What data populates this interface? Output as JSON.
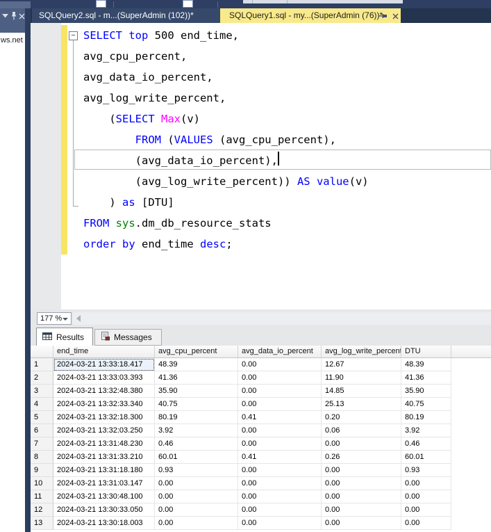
{
  "colors": {
    "title_strip": "#2E3F63",
    "tabbar_bg": "#24344F",
    "inactive_tab_bg": "#36496B",
    "active_tab_bg": "#F8E98B",
    "panel_header_bg": "#4D5F82",
    "change_bar_yellow": "#F7E464",
    "keyword_blue": "#0000FF",
    "function_magenta": "#FF00FF",
    "system_green": "#007F00"
  },
  "left_panel": {
    "server_text": "ws.net (S",
    "header_icons": [
      "chevron-down",
      "pin",
      "close"
    ]
  },
  "tabs": [
    {
      "label": "SQLQuery2.sql - m...(SuperAdmin (102))*",
      "active": false
    },
    {
      "label": "SQLQuery1.sql - my...(SuperAdmin (76))*",
      "active": true,
      "icons": [
        "pin",
        "close"
      ]
    }
  ],
  "editor": {
    "zoom_level": "177 %",
    "caret_line": 7,
    "lines": [
      [
        {
          "t": "SELECT",
          "c": "kw"
        },
        {
          "t": " ",
          "c": "pl"
        },
        {
          "t": "top",
          "c": "kw"
        },
        {
          "t": " 500 end_time,",
          "c": "pl"
        }
      ],
      [
        {
          "t": "avg_cpu_percent,",
          "c": "pl"
        }
      ],
      [
        {
          "t": "avg_data_io_percent,",
          "c": "pl"
        }
      ],
      [
        {
          "t": "avg_log_write_percent,",
          "c": "pl"
        }
      ],
      [
        {
          "t": "    (",
          "c": "pl"
        },
        {
          "t": "SELECT",
          "c": "kw"
        },
        {
          "t": " ",
          "c": "pl"
        },
        {
          "t": "Max",
          "c": "fn"
        },
        {
          "t": "(v)",
          "c": "pl"
        }
      ],
      [
        {
          "t": "        ",
          "c": "pl"
        },
        {
          "t": "FROM",
          "c": "kw"
        },
        {
          "t": " (",
          "c": "pl"
        },
        {
          "t": "VALUES",
          "c": "kw"
        },
        {
          "t": " (avg_cpu_percent),",
          "c": "pl"
        }
      ],
      [
        {
          "t": "        (avg_data_io_percent),",
          "c": "pl"
        }
      ],
      [
        {
          "t": "        (avg_log_write_percent)) ",
          "c": "pl"
        },
        {
          "t": "AS",
          "c": "kw"
        },
        {
          "t": " ",
          "c": "pl"
        },
        {
          "t": "value",
          "c": "kw"
        },
        {
          "t": "(v)",
          "c": "pl"
        }
      ],
      [
        {
          "t": "    ) ",
          "c": "pl"
        },
        {
          "t": "as",
          "c": "kw"
        },
        {
          "t": " [DTU]",
          "c": "pl"
        }
      ],
      [
        {
          "t": "FROM",
          "c": "kw"
        },
        {
          "t": " ",
          "c": "pl"
        },
        {
          "t": "sys",
          "c": "sys"
        },
        {
          "t": ".dm_db_resource_stats",
          "c": "pl"
        }
      ],
      [
        {
          "t": "order",
          "c": "kw"
        },
        {
          "t": " ",
          "c": "pl"
        },
        {
          "t": "by",
          "c": "kw"
        },
        {
          "t": " end_time ",
          "c": "pl"
        },
        {
          "t": "desc",
          "c": "kw"
        },
        {
          "t": ";",
          "c": "pl"
        }
      ]
    ]
  },
  "results": {
    "tabs": [
      {
        "label": "Results"
      },
      {
        "label": "Messages"
      }
    ],
    "grid": {
      "columns": [
        "end_time",
        "avg_cpu_percent",
        "avg_data_io_percent",
        "avg_log_write_percent",
        "DTU"
      ],
      "selected_cell": {
        "row": 1,
        "column": "end_time"
      },
      "rows": [
        [
          "2024-03-21 13:33:18.417",
          "48.39",
          "0.00",
          "12.67",
          "48.39"
        ],
        [
          "2024-03-21 13:33:03.393",
          "41.36",
          "0.00",
          "11.90",
          "41.36"
        ],
        [
          "2024-03-21 13:32:48.380",
          "35.90",
          "0.00",
          "14.85",
          "35.90"
        ],
        [
          "2024-03-21 13:32:33.340",
          "40.75",
          "0.00",
          "25.13",
          "40.75"
        ],
        [
          "2024-03-21 13:32:18.300",
          "80.19",
          "0.41",
          "0.20",
          "80.19"
        ],
        [
          "2024-03-21 13:32:03.250",
          "3.92",
          "0.00",
          "0.06",
          "3.92"
        ],
        [
          "2024-03-21 13:31:48.230",
          "0.46",
          "0.00",
          "0.00",
          "0.46"
        ],
        [
          "2024-03-21 13:31:33.210",
          "60.01",
          "0.41",
          "0.26",
          "60.01"
        ],
        [
          "2024-03-21 13:31:18.180",
          "0.93",
          "0.00",
          "0.00",
          "0.93"
        ],
        [
          "2024-03-21 13:31:03.147",
          "0.00",
          "0.00",
          "0.00",
          "0.00"
        ],
        [
          "2024-03-21 13:30:48.100",
          "0.00",
          "0.00",
          "0.00",
          "0.00"
        ],
        [
          "2024-03-21 13:30:33.050",
          "0.00",
          "0.00",
          "0.00",
          "0.00"
        ],
        [
          "2024-03-21 13:30:18.003",
          "0.00",
          "0.00",
          "0.00",
          "0.00"
        ]
      ]
    }
  }
}
